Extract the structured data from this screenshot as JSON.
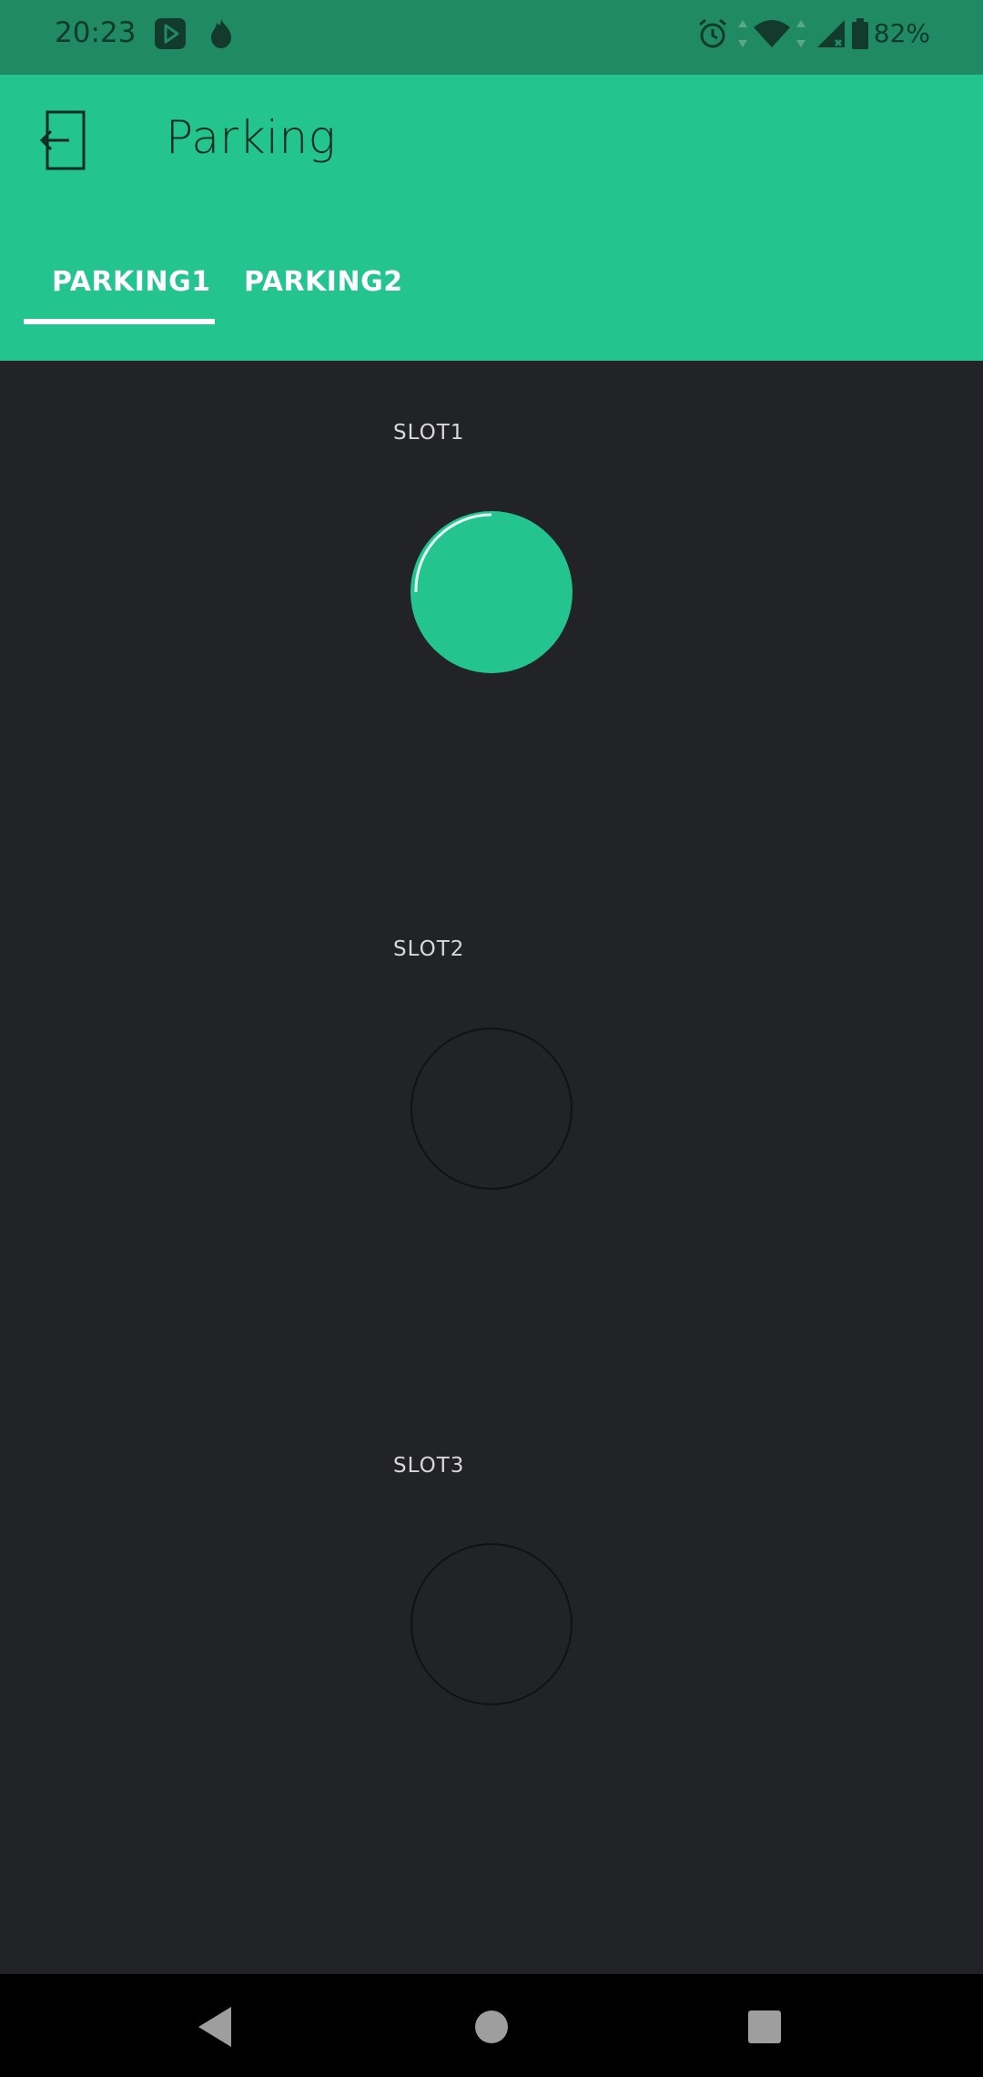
{
  "status_bar": {
    "time": "20:23",
    "battery_text": "82%",
    "icons": [
      "play-store-icon",
      "fire-icon",
      "alarm-icon",
      "data-arrows-icon",
      "wifi-icon",
      "signal-icon",
      "battery-icon"
    ]
  },
  "app_bar": {
    "title": "Parking",
    "logout_icon": "logout-icon",
    "tabs": [
      {
        "label": "PARKING1",
        "selected": true
      },
      {
        "label": "PARKING2",
        "selected": false
      }
    ]
  },
  "slots": [
    {
      "label": "SLOT1",
      "led_state": "on"
    },
    {
      "label": "SLOT2",
      "led_state": "off"
    },
    {
      "label": "SLOT3",
      "led_state": "off"
    }
  ],
  "colors": {
    "accent": "#23c48e",
    "status_bar": "#1f8a63",
    "background": "#222327",
    "nav_bar": "#000000"
  },
  "nav": {
    "back_icon": "back-triangle-icon",
    "home_icon": "home-circle-icon",
    "recent_icon": "recents-square-icon"
  }
}
